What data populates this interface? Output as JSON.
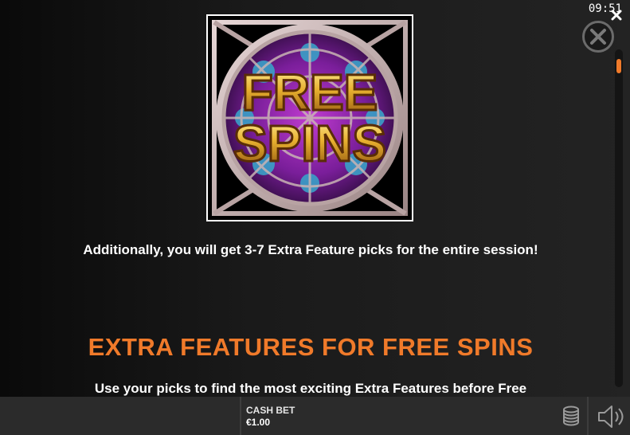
{
  "status": {
    "clock": "09:51"
  },
  "feature_image": {
    "title_line1": "FREE",
    "title_line2": "SPINS"
  },
  "content": {
    "description": "Additionally, you will get 3-7 Extra Feature picks for the entire session!",
    "section_title": "EXTRA FEATURES FOR FREE SPINS",
    "cut_text": "Use your picks to find the most exciting Extra Features before Free"
  },
  "bottom_bar": {
    "cash_bet_label": "CASH BET",
    "cash_bet_value": "€1.00"
  },
  "colors": {
    "accent": "#f07a2a",
    "background": "#1e1e1e",
    "bar": "#2b2b2b"
  },
  "icons": [
    "close-icon",
    "chips-icon",
    "sound-icon"
  ]
}
